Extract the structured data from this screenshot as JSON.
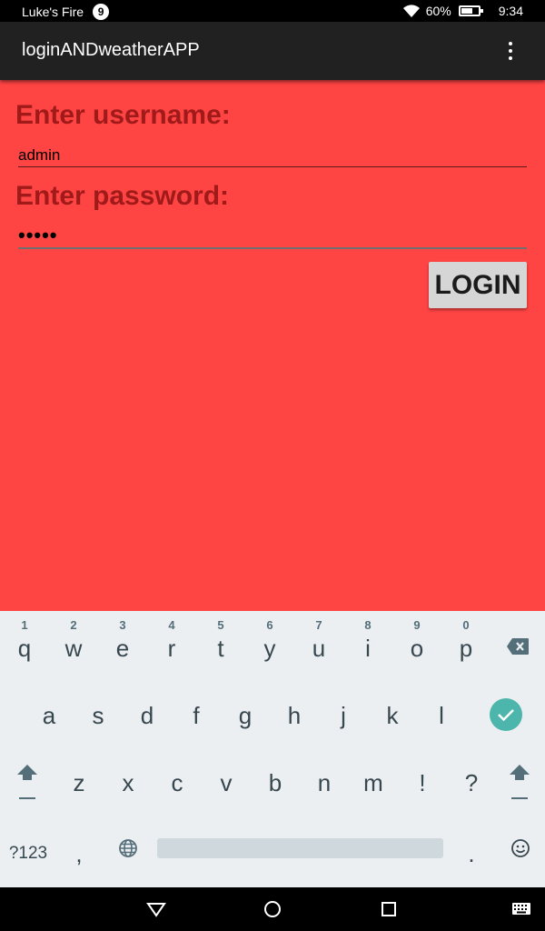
{
  "status_bar": {
    "carrier": "Luke's Fire",
    "notification_count": "9",
    "battery": "60%",
    "battery_level": 0.6,
    "time": "9:34"
  },
  "app_bar": {
    "title": "loginANDweatherAPP",
    "menu_icon": "overflow-menu-icon"
  },
  "form": {
    "username_label": "Enter username:",
    "username_value": "admin",
    "password_label": "Enter password:",
    "password_value": "•••••",
    "login_label": "LOGIN"
  },
  "colors": {
    "background": "#ff4444",
    "label": "#a11a1a",
    "app_bar": "#212121",
    "keyboard": "#eceff1",
    "enter_key": "#4db6ac"
  },
  "keyboard": {
    "row1": [
      {
        "key": "q",
        "hint": "1"
      },
      {
        "key": "w",
        "hint": "2"
      },
      {
        "key": "e",
        "hint": "3"
      },
      {
        "key": "r",
        "hint": "4"
      },
      {
        "key": "t",
        "hint": "5"
      },
      {
        "key": "y",
        "hint": "6"
      },
      {
        "key": "u",
        "hint": "7"
      },
      {
        "key": "i",
        "hint": "8"
      },
      {
        "key": "o",
        "hint": "9"
      },
      {
        "key": "p",
        "hint": "0"
      }
    ],
    "row2": [
      "a",
      "s",
      "d",
      "f",
      "g",
      "h",
      "j",
      "k",
      "l"
    ],
    "row3": [
      "z",
      "x",
      "c",
      "v",
      "b",
      "n",
      "m",
      "!",
      "?"
    ],
    "symbols_key": "?123",
    "comma_key": ",",
    "period_key": ".",
    "icons": [
      "backspace-icon",
      "enter-check-icon",
      "shift-icon",
      "globe-icon",
      "emoji-icon"
    ]
  },
  "nav_bar": {
    "icons": [
      "back-icon",
      "home-icon",
      "recents-icon",
      "keyboard-switch-icon"
    ]
  }
}
